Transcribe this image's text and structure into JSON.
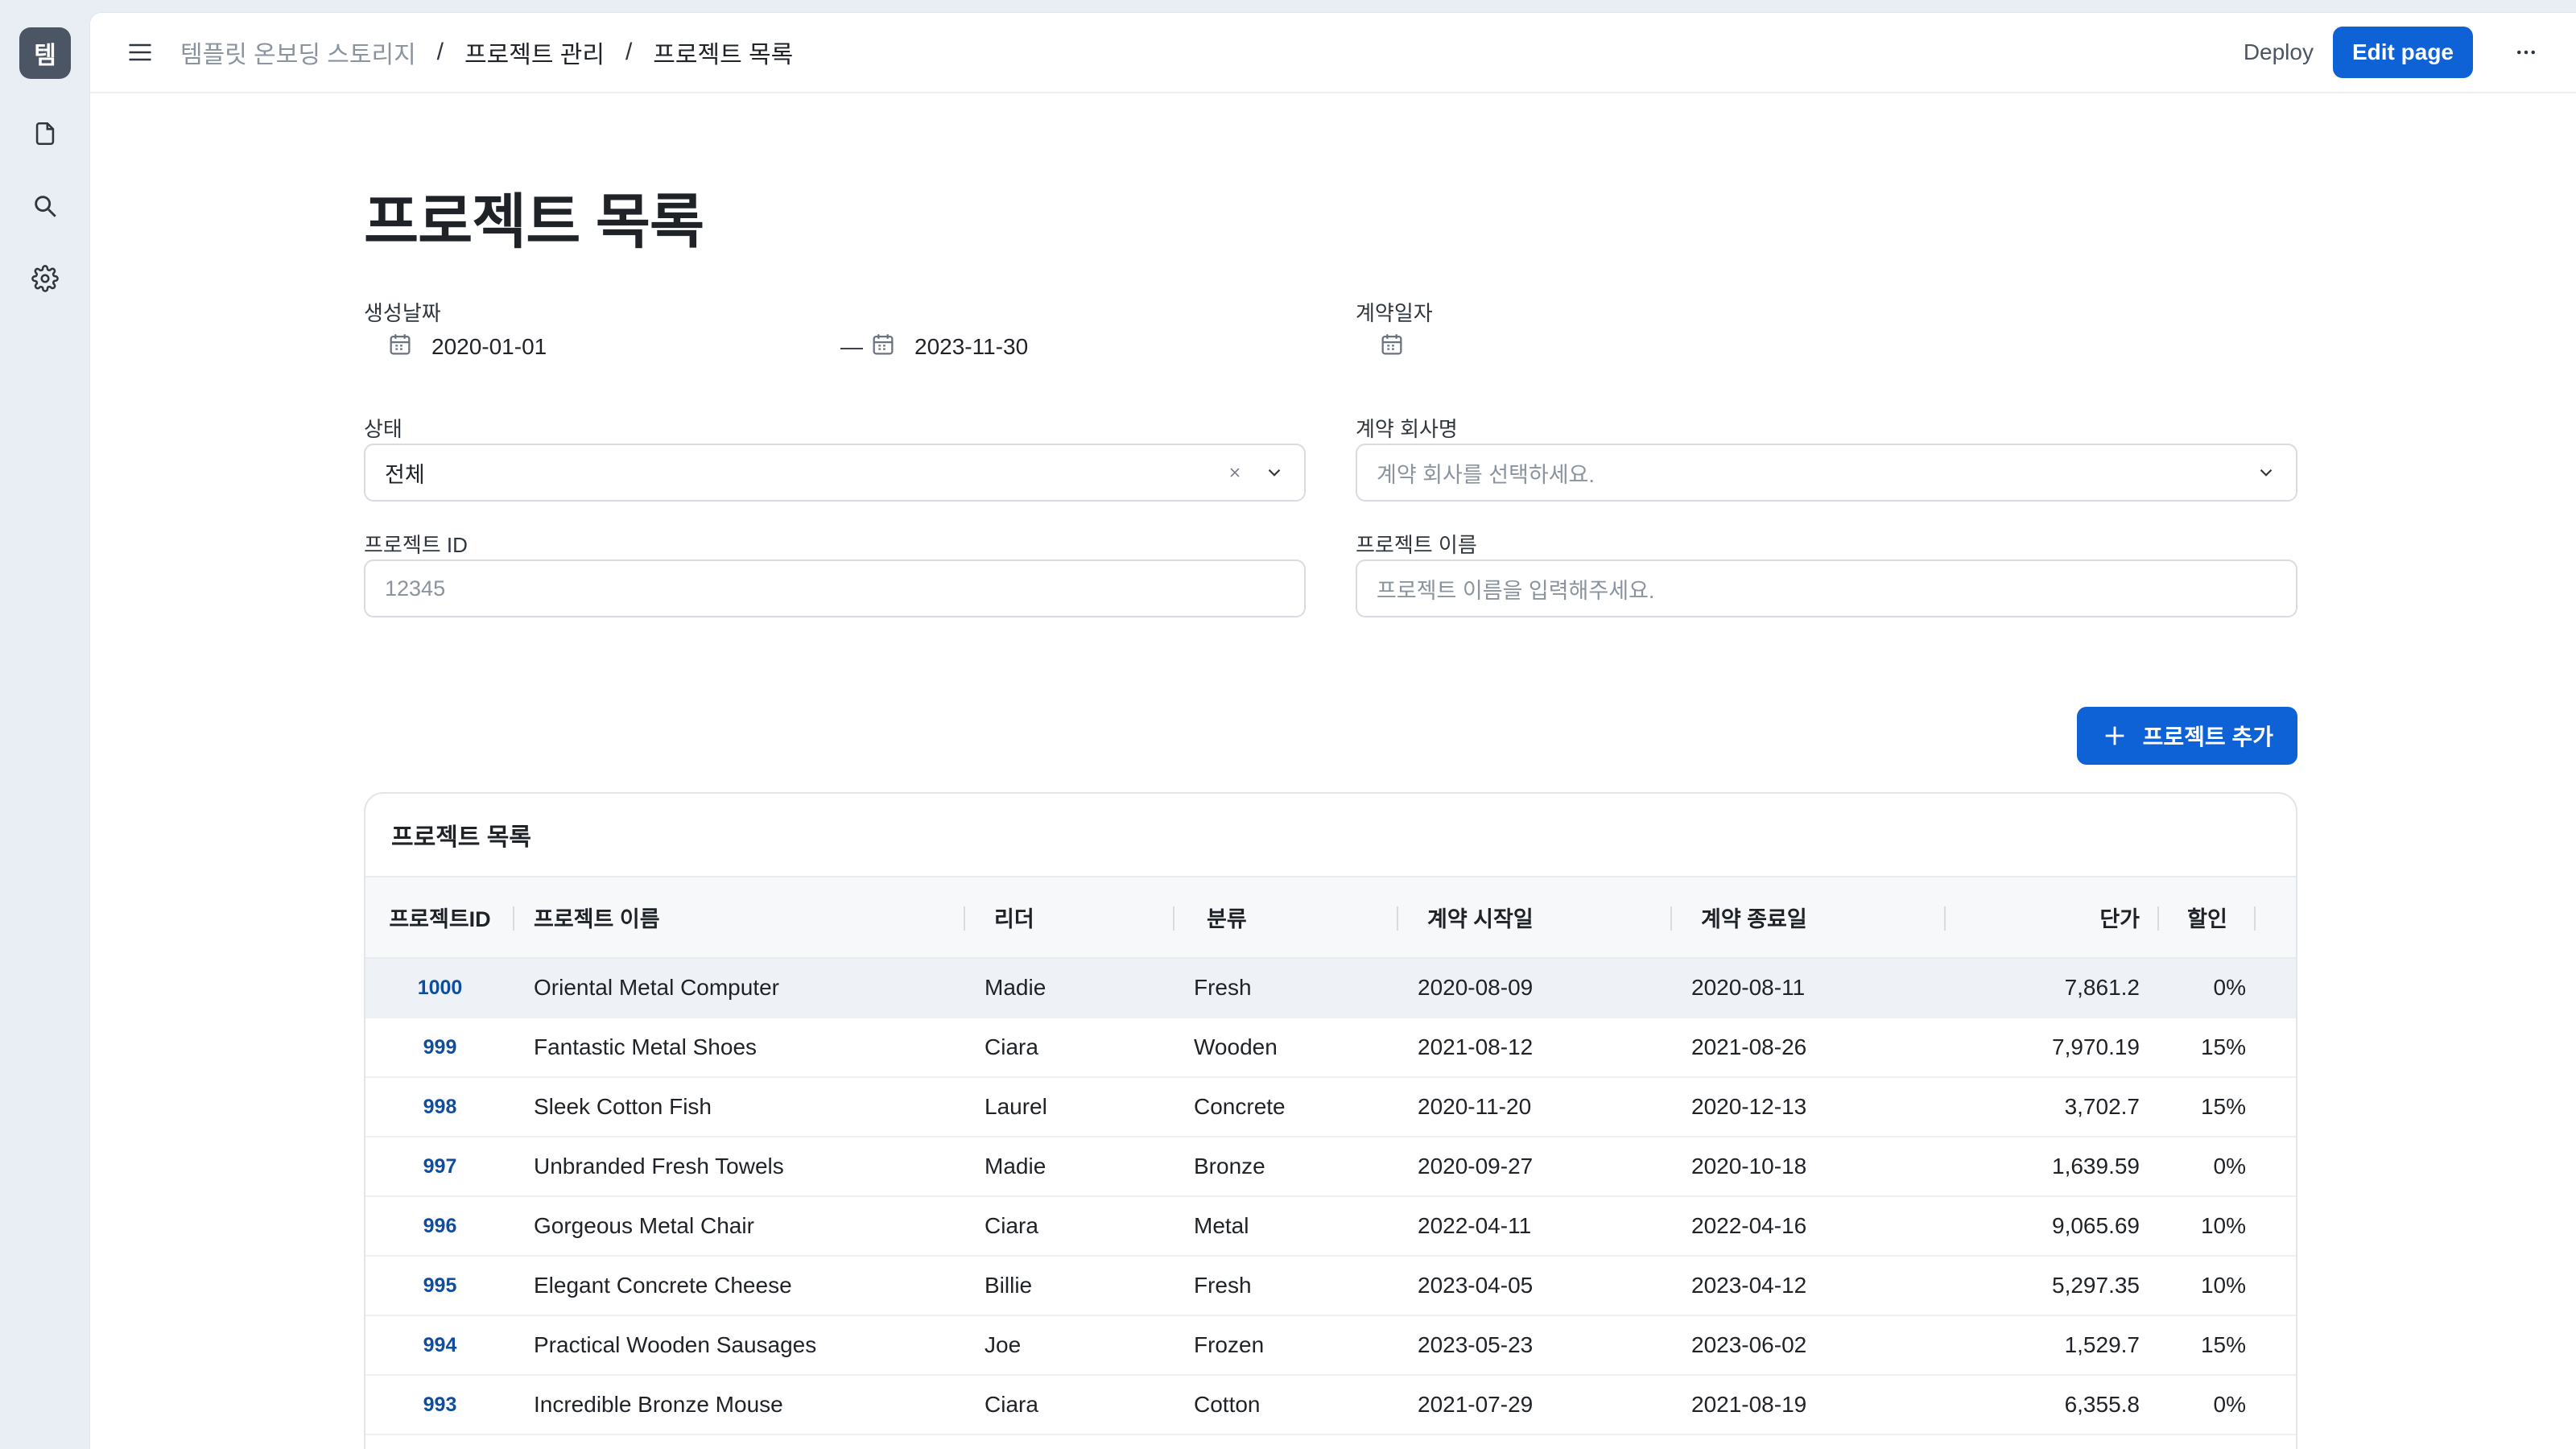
{
  "app": {
    "avatar_letter": "템"
  },
  "rail": {
    "icons": [
      "document-icon",
      "search-icon",
      "gear-icon"
    ]
  },
  "topbar": {
    "breadcrumb": [
      "템플릿 온보딩 스토리지",
      "프로젝트 관리",
      "프로젝트 목록"
    ],
    "separator": "/",
    "deploy_label": "Deploy",
    "edit_label": "Edit page"
  },
  "page": {
    "title": "프로젝트 목록"
  },
  "filters": {
    "created_date": {
      "label": "생성날짜",
      "start": "2020-01-01",
      "dash": "—",
      "end": "2023-11-30"
    },
    "contract_date": {
      "label": "계약일자",
      "value": ""
    },
    "status": {
      "label": "상태",
      "value": "전체"
    },
    "company": {
      "label": "계약 회사명",
      "placeholder": "계약 회사를 선택하세요."
    },
    "project_id": {
      "label": "프로젝트 ID",
      "placeholder": "12345"
    },
    "project_name": {
      "label": "프로젝트 이름",
      "placeholder": "프로젝트 이름을 입력해주세요."
    }
  },
  "add_button_label": "프로젝트 추가",
  "table": {
    "title": "프로젝트 목록",
    "columns": [
      "프로젝트ID",
      "프로젝트 이름",
      "리더",
      "분류",
      "계약 시작일",
      "계약 종료일",
      "단가",
      "할인"
    ],
    "rows": [
      [
        "1000",
        "Oriental Metal Computer",
        "Madie",
        "Fresh",
        "2020-08-09",
        "2020-08-11",
        "7,861.2",
        "0%"
      ],
      [
        "999",
        "Fantastic Metal Shoes",
        "Ciara",
        "Wooden",
        "2021-08-12",
        "2021-08-26",
        "7,970.19",
        "15%"
      ],
      [
        "998",
        "Sleek Cotton Fish",
        "Laurel",
        "Concrete",
        "2020-11-20",
        "2020-12-13",
        "3,702.7",
        "15%"
      ],
      [
        "997",
        "Unbranded Fresh Towels",
        "Madie",
        "Bronze",
        "2020-09-27",
        "2020-10-18",
        "1,639.59",
        "0%"
      ],
      [
        "996",
        "Gorgeous Metal Chair",
        "Ciara",
        "Metal",
        "2022-04-11",
        "2022-04-16",
        "9,065.69",
        "10%"
      ],
      [
        "995",
        "Elegant Concrete Cheese",
        "Billie",
        "Fresh",
        "2023-04-05",
        "2023-04-12",
        "5,297.35",
        "10%"
      ],
      [
        "994",
        "Practical Wooden Sausages",
        "Joe",
        "Frozen",
        "2023-05-23",
        "2023-06-02",
        "1,529.7",
        "15%"
      ],
      [
        "993",
        "Incredible Bronze Mouse",
        "Ciara",
        "Cotton",
        "2021-07-29",
        "2021-08-19",
        "6,355.8",
        "0%"
      ]
    ]
  },
  "colors": {
    "accent": "#0f62d6",
    "id_text": "#0f4d9e",
    "highlight_row": "#eef2f7"
  }
}
